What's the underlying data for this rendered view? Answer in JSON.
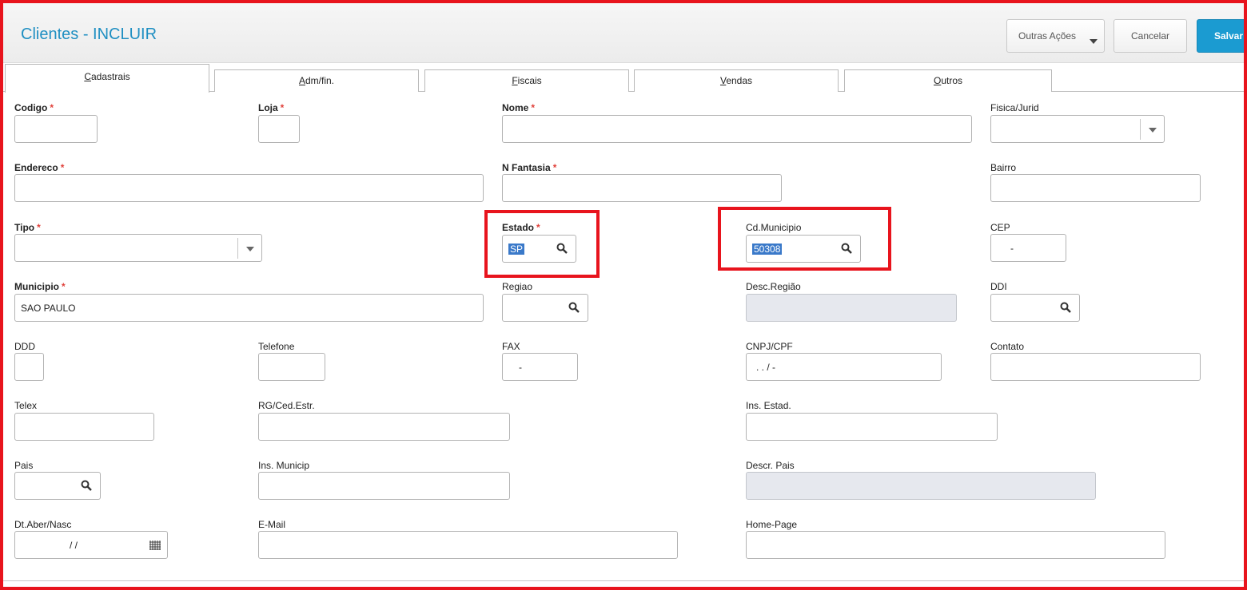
{
  "header": {
    "title": "Clientes - INCLUIR",
    "buttons": {
      "outras_acoes": "Outras Ações",
      "cancelar": "Cancelar",
      "salvar": "Salvar"
    }
  },
  "tabs": [
    {
      "label_u": "C",
      "label_rest": "adastrais",
      "active": true
    },
    {
      "label_u": "A",
      "label_rest": "dm/fin.",
      "active": false
    },
    {
      "label_u": "F",
      "label_rest": "iscais",
      "active": false
    },
    {
      "label_u": "V",
      "label_rest": "endas",
      "active": false
    },
    {
      "label_u": "O",
      "label_rest": "utros",
      "active": false
    }
  ],
  "required_marker": "*",
  "fields": {
    "codigo": {
      "label": "Codigo",
      "value": ""
    },
    "loja": {
      "label": "Loja",
      "value": ""
    },
    "nome": {
      "label": "Nome",
      "value": ""
    },
    "fisica_jurid": {
      "label": "Fisica/Jurid",
      "value": ""
    },
    "endereco": {
      "label": "Endereco",
      "value": ""
    },
    "n_fantasia": {
      "label": "N Fantasia",
      "value": ""
    },
    "bairro": {
      "label": "Bairro",
      "value": ""
    },
    "tipo": {
      "label": "Tipo",
      "value": ""
    },
    "estado": {
      "label": "Estado",
      "value": "SP"
    },
    "cd_municipio": {
      "label": "Cd.Municipio",
      "value": "50308"
    },
    "cep": {
      "label": "CEP",
      "value": "-"
    },
    "municipio": {
      "label": "Municipio",
      "value": "SAO PAULO"
    },
    "regiao": {
      "label": "Regiao",
      "value": ""
    },
    "desc_regiao": {
      "label": "Desc.Região",
      "value": ""
    },
    "ddi": {
      "label": "DDI",
      "value": ""
    },
    "ddd": {
      "label": "DDD",
      "value": ""
    },
    "telefone": {
      "label": "Telefone",
      "value": ""
    },
    "fax": {
      "label": "FAX",
      "value": "-"
    },
    "cnpj_cpf": {
      "label": "CNPJ/CPF",
      "value": ". . / -"
    },
    "contato": {
      "label": "Contato",
      "value": ""
    },
    "telex": {
      "label": "Telex",
      "value": ""
    },
    "rg_ced_estr": {
      "label": "RG/Ced.Estr.",
      "value": ""
    },
    "ins_estad": {
      "label": "Ins. Estad.",
      "value": ""
    },
    "pais": {
      "label": "Pais",
      "value": ""
    },
    "ins_municip": {
      "label": "Ins. Municip",
      "value": ""
    },
    "descr_pais": {
      "label": "Descr. Pais",
      "value": ""
    },
    "dt_aber_nasc": {
      "label": "Dt.Aber/Nasc",
      "value": "/ /"
    },
    "email": {
      "label": "E-Mail",
      "value": ""
    },
    "home_page": {
      "label": "Home-Page",
      "value": ""
    }
  },
  "colors": {
    "title": "#1f8fc2",
    "primary_button": "#1b9bd1",
    "highlight": "#e8141d",
    "required": "#e0403a",
    "selection": "#3a79c9"
  }
}
